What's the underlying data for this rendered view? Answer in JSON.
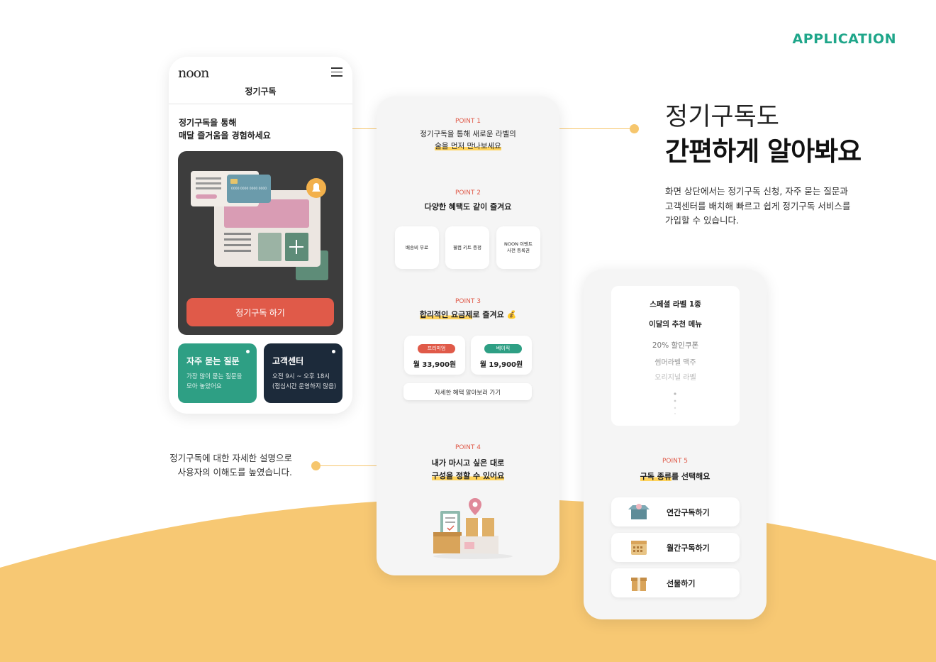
{
  "colors": {
    "accent_green": "#1fa68a",
    "coral": "#e05a49",
    "teal": "#2e9f84",
    "navy": "#1c2a3a",
    "yellow": "#f7c873",
    "highlight": "#ffd35c"
  },
  "page": {
    "section_label": "APPLICATION"
  },
  "headline": {
    "line1": "정기구독도",
    "line2": "간편하게 알아봐요",
    "desc_lines": [
      "화면 상단에서는 정기구독 신청, 자주 묻는 질문과",
      "고객센터를 배치해 빠르고 쉽게 정기구독 서비스를",
      "가입할 수 있습니다."
    ]
  },
  "left_note": {
    "lines": [
      "정기구독에 대한 자세한 설명으로",
      "사용자의 이해도를 높였습니다."
    ]
  },
  "phone1": {
    "logo": "noon",
    "title": "정기구독",
    "intro_lines": [
      "정기구독을 통해",
      "매달 즐거움을 경험하세요"
    ],
    "card_number": "0000 0000 0000 0000",
    "subscribe_label": "정기구독 하기",
    "faq": {
      "title": "자주 묻는 질문",
      "desc_lines": [
        "가장 많이 묻는 질문을",
        "모아 놓았어요"
      ]
    },
    "support": {
      "title": "고객센터",
      "desc_lines": [
        "오전 9시 ~ 오후 18시",
        "(점심시간 운영하지 않음)"
      ]
    }
  },
  "phone2": {
    "p1": {
      "label": "POINT 1",
      "line1": "정기구독을 통해  새로운 라벨의",
      "line2": "술을 먼저 만나보세요"
    },
    "p2": {
      "label": "POINT 2",
      "title": "다양한 혜택도 같이 즐겨요",
      "benefits": [
        "배송비 무료",
        "웰컴 키트 증정",
        "NOON 이벤트\n사전 등록권"
      ]
    },
    "p3": {
      "label": "POINT 3",
      "title_hl": "합리적인 요금제",
      "title_rest": "로 즐겨요 💰",
      "plans": [
        {
          "badge": "프리미엄",
          "price": "월 33,900원"
        },
        {
          "badge": "베이직",
          "price": "월 19,900원"
        }
      ],
      "detail_label": "자세한 혜택 알아보러 가기"
    },
    "p4": {
      "label": "POINT 4",
      "line1": "내가 마시고 싶은 대로",
      "line2": "구성을 정할 수 있어요"
    }
  },
  "phone3": {
    "menu": [
      "스페셜 라벨 1종",
      "이달의 추천 메뉴",
      "20% 할인쿠폰",
      "썸머라벨 맥주",
      "오리지널 라벨"
    ],
    "p5": {
      "label": "POINT 5",
      "title_hl": "구독 종류",
      "title_rest": "를 선택해요"
    },
    "options": [
      {
        "label": "연간구독하기",
        "icon": "box-icon"
      },
      {
        "label": "월간구독하기",
        "icon": "calendar-icon"
      },
      {
        "label": "선물하기",
        "icon": "gift-icon"
      }
    ]
  }
}
